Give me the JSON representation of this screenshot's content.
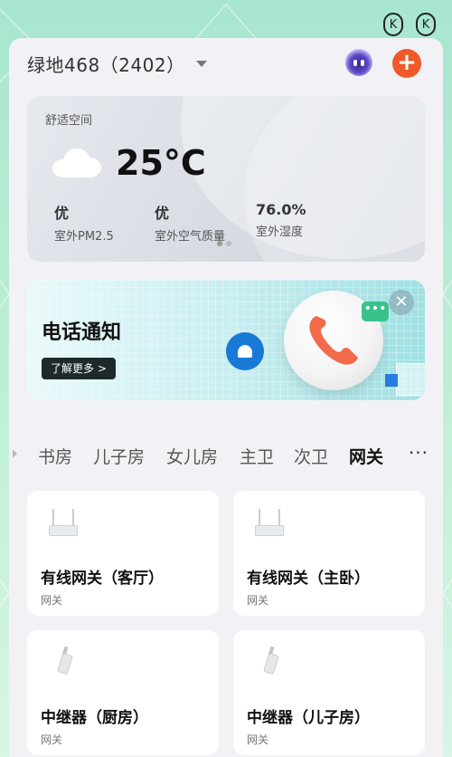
{
  "status": {
    "icon_a": "k-circle-icon",
    "icon_b": "k-circle-icon"
  },
  "header": {
    "home_name": "绿地468（2402）",
    "assistant_icon": "robot-icon",
    "add_icon": "plus-icon",
    "add_glyph": "+"
  },
  "weather": {
    "section_label": "舒适空间",
    "icon": "cloud-icon",
    "temperature": "25°C",
    "metrics": [
      {
        "value": "优",
        "label": "室外PM2.5"
      },
      {
        "value": "优",
        "label": "室外空气质量"
      },
      {
        "value": "76.0%",
        "label": "室外湿度"
      }
    ],
    "page_count": 2,
    "active_page": 1
  },
  "banner": {
    "title": "电话通知",
    "button_label": "了解更多 >",
    "chat_glyph": "•••",
    "close_glyph": "✕"
  },
  "rooms": {
    "tabs": [
      "书房",
      "儿子房",
      "女儿房",
      "主卫",
      "次卫",
      "网关"
    ],
    "active": "网关",
    "more_glyph": "···"
  },
  "devices": [
    {
      "name": "有线网关（客厅）",
      "type": "网关",
      "icon": "router-icon"
    },
    {
      "name": "有线网关（主卧）",
      "type": "网关",
      "icon": "router-icon"
    },
    {
      "name": "中继器（厨房）",
      "type": "网关",
      "icon": "repeater-icon"
    },
    {
      "name": "中继器（儿子房）",
      "type": "网关",
      "icon": "repeater-icon"
    }
  ],
  "colors": {
    "accent": "#f05a2a",
    "active_tab": "#111111",
    "banner_button": "#1e2a2a"
  }
}
